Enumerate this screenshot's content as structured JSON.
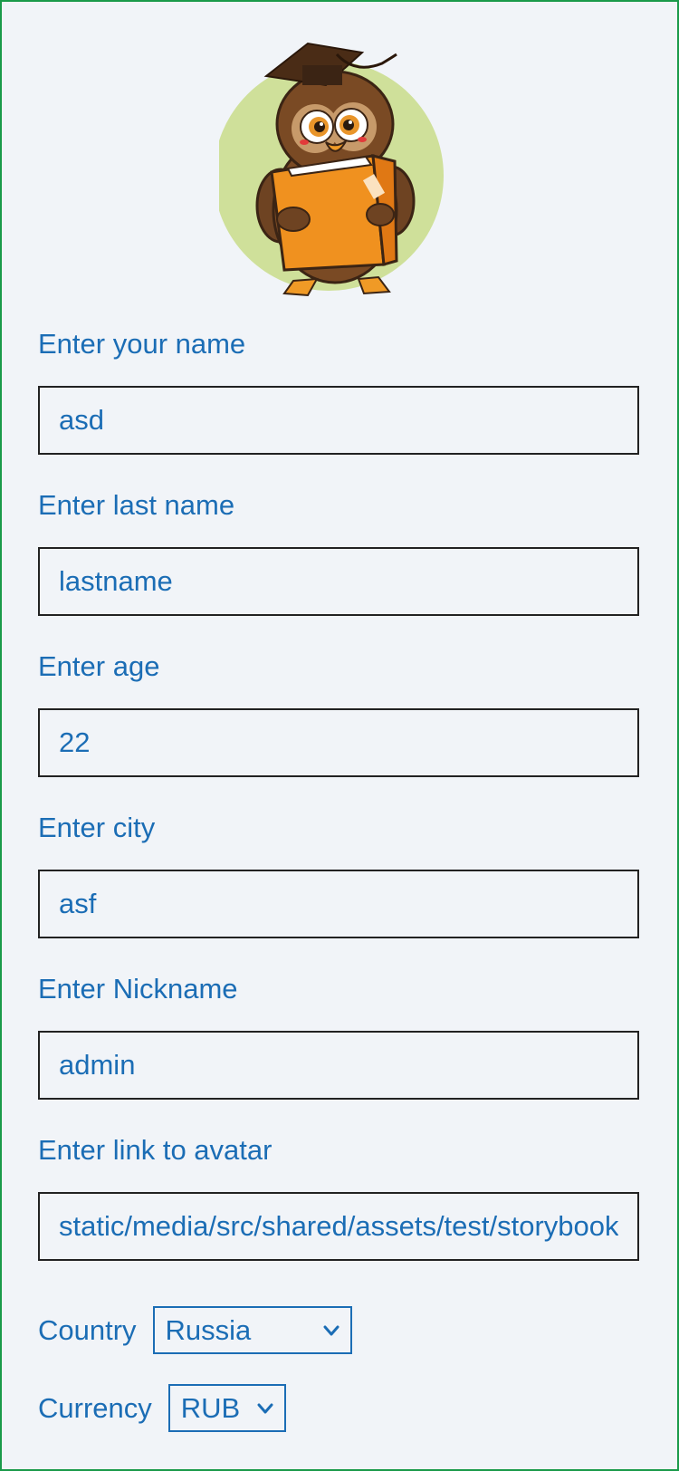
{
  "form": {
    "fields": [
      {
        "label": "Enter your name",
        "value": "asd"
      },
      {
        "label": "Enter last name",
        "value": "lastname"
      },
      {
        "label": "Enter age",
        "value": "22"
      },
      {
        "label": "Enter city",
        "value": "asf"
      },
      {
        "label": "Enter Nickname",
        "value": "admin"
      },
      {
        "label": "Enter link to avatar",
        "value": "static/media/src/shared/assets/test/storybook.jpg"
      }
    ],
    "country": {
      "label": "Country",
      "value": "Russia"
    },
    "currency": {
      "label": "Currency",
      "value": "RUB"
    }
  },
  "icons": {
    "avatar": "owl-reading-book",
    "select_arrow": "chevron-down-icon"
  },
  "colors": {
    "text": "#1b6db5",
    "background": "#f1f4f8",
    "frame_border": "#1a9a4a",
    "input_border": "#222222"
  }
}
